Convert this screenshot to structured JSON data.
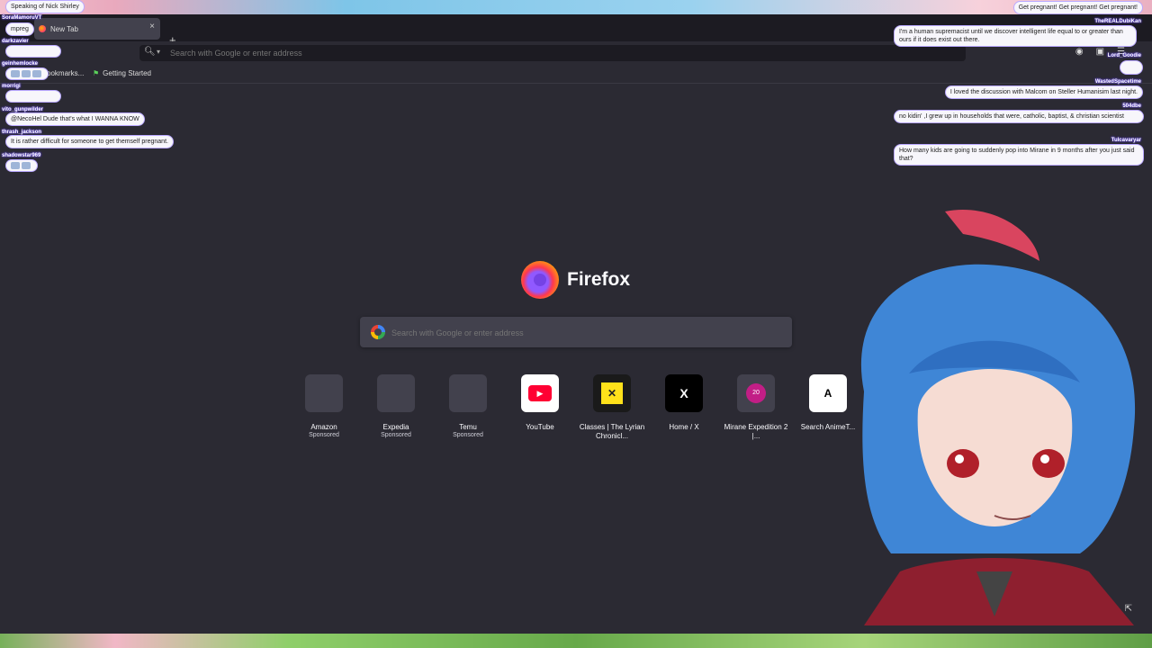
{
  "browser": {
    "tab_title": "New Tab",
    "tab_close": "×",
    "new_tab_symbol": "+",
    "url_placeholder": "Search with Google or enter address",
    "bookmarks": [
      {
        "label": "ookmarks..."
      },
      {
        "label": "Getting Started"
      }
    ]
  },
  "newtab": {
    "brand": "Firefox",
    "search_placeholder": "Search with Google or enter address",
    "shortcuts": [
      {
        "name": "Amazon",
        "sub": "Sponsored",
        "icon": ""
      },
      {
        "name": "Expedia",
        "sub": "Sponsored",
        "icon": ""
      },
      {
        "name": "Temu",
        "sub": "Sponsored",
        "icon": ""
      },
      {
        "name": "YouTube",
        "sub": "",
        "icon": "▶"
      },
      {
        "name": "Classes | The Lyrian Chronicl...",
        "sub": "",
        "icon": "✕"
      },
      {
        "name": "Home / X",
        "sub": "",
        "icon": "X"
      },
      {
        "name": "Mirane Expedition 2 |...",
        "sub": "",
        "icon": "20"
      },
      {
        "name": "Search AnimeT...",
        "sub": "",
        "icon": "A"
      }
    ]
  },
  "chat_left": [
    {
      "user": "",
      "text": "Speaking of Nick Shirley"
    },
    {
      "user": "SoraMamoruVT",
      "text": "mpreg"
    },
    {
      "user": "darkzavier",
      "text": ""
    },
    {
      "user": "geinhemlocke",
      "text": ""
    },
    {
      "user": "morrigi",
      "text": ""
    },
    {
      "user": "vito_gunpwilder",
      "text": "@NecoHel Dude that's what I WANNA KNOW"
    },
    {
      "user": "thrash_jackson",
      "text": "It is rather difficult for someone to get themself pregnant."
    },
    {
      "user": "shadowstar969",
      "text": ""
    }
  ],
  "chat_right": [
    {
      "user": "",
      "text": "Get pregnant! Get pregnant! Get pregnant!"
    },
    {
      "user": "TheREALDubiKan",
      "text": "I'm a human supremacist until we discover intelligent life equal to or greater than ours if it does exist out there."
    },
    {
      "user": "Lord_Goodie",
      "text": ""
    },
    {
      "user": "WastedSpacetime",
      "text": "I loved the discussion with Malcom on Steller Humanisim last night."
    },
    {
      "user": "504dbe",
      "text": "no kidin' ,I grew up in households that were, catholic, baptist, & christian scientist"
    },
    {
      "user": "Tulcavaryar",
      "text": "How many kids are going to suddenly pop into Mirane in 9 months after you just said that?"
    }
  ]
}
